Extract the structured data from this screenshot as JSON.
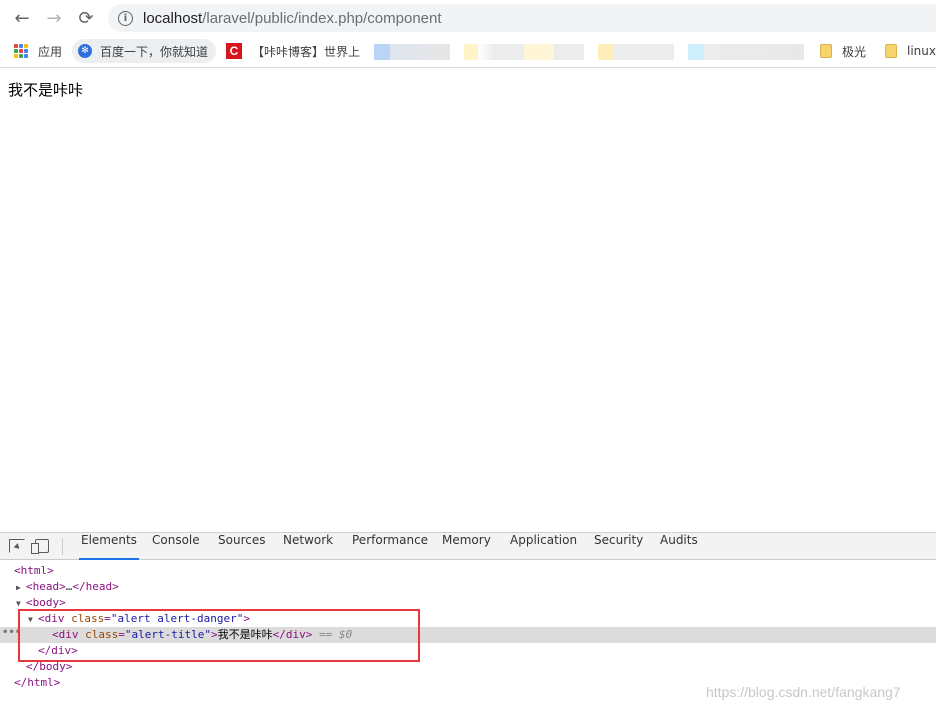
{
  "browser": {
    "nav": {
      "back": "←",
      "forward": "→",
      "reload": "⟳"
    },
    "url": {
      "host": "localhost",
      "path": "/laravel/public/index.php/component"
    },
    "bookmarks": {
      "apps": "应用",
      "baidu": "百度一下，你就知道",
      "kaka": "【咔咔博客】世界上",
      "folder_a": "极光",
      "folder_b": "linux"
    }
  },
  "page": {
    "text": "我不是咔咔"
  },
  "devtools": {
    "tabs": [
      "Elements",
      "Console",
      "Sources",
      "Network",
      "Performance",
      "Memory",
      "Application",
      "Security",
      "Audits"
    ],
    "active_tab": "Elements",
    "tree": {
      "html_open": "<html>",
      "head": "<head>",
      "head_ellipsis": "…",
      "head_close": "</head>",
      "body_open": "<body>",
      "div_open_tag": "<div",
      "div_class_attr": "class",
      "div_class_value": "\"alert alert-danger\"",
      "div_open_end": ">",
      "inner_open_tag": "<div",
      "inner_class_attr": "class",
      "inner_class_value": "\"alert-title\"",
      "inner_open_end": ">",
      "inner_text": "我不是咔咔",
      "inner_close": "</div>",
      "selected_marker": "== $0",
      "div_close": "</div>",
      "body_close": "</body>",
      "html_close": "</html>"
    }
  },
  "watermark": "https://blog.csdn.net/fangkang7"
}
